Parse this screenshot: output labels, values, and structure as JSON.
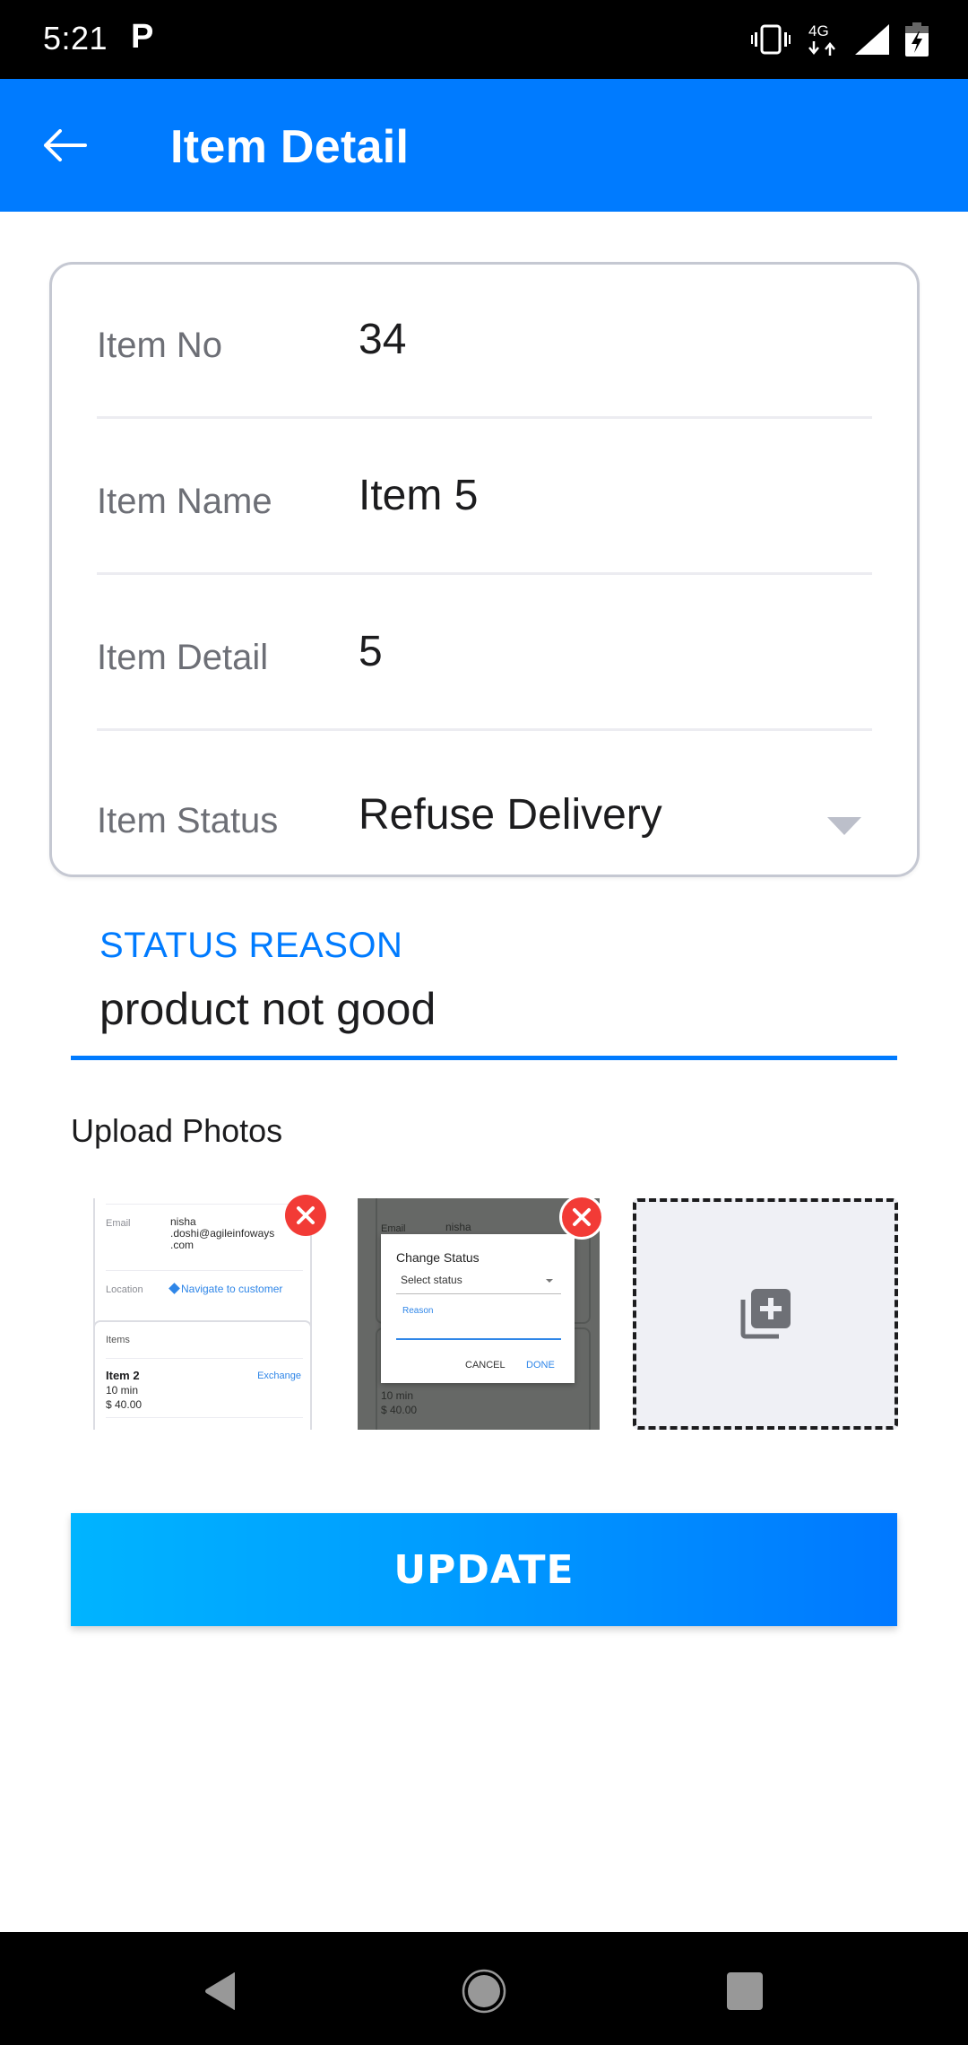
{
  "status_bar": {
    "time": "5:21",
    "notification_icon": "P",
    "network_label": "4G",
    "icons": [
      "vibrate-icon",
      "network-4g-icon",
      "signal-icon",
      "battery-charging-icon"
    ]
  },
  "app_bar": {
    "title": "Item Detail",
    "back_icon": "arrow-left-icon",
    "color": "#007bff"
  },
  "detail_card": {
    "rows": [
      {
        "label": "Item No",
        "value": "34"
      },
      {
        "label": "Item Name",
        "value": "Item 5"
      },
      {
        "label": "Item Detail",
        "value": "5"
      },
      {
        "label": "Item Status",
        "value": "Refuse Delivery"
      }
    ]
  },
  "status_reason": {
    "label": "STATUS REASON",
    "value": "product not good"
  },
  "upload": {
    "label": "Upload Photos",
    "photos": [
      {
        "email_label": "Email",
        "email_lines": [
          "nisha",
          ".doshi@agileinfoways",
          ".com"
        ],
        "location_label": "Location",
        "navigate_link": "Navigate to customer",
        "items_heading": "Items",
        "item_name": "Item 2",
        "item_action": "Exchange",
        "item_time": "10 min",
        "item_price": "$ 40.00"
      },
      {
        "email_label": "Email",
        "email_value": "nisha",
        "dialog_title": "Change Status",
        "select_placeholder": "Select status",
        "reason_label": "Reason",
        "cancel_label": "CANCEL",
        "done_label": "DONE",
        "item_time": "10 min",
        "item_price": "$ 40.00"
      }
    ],
    "add_icon": "add-photo-icon"
  },
  "update_button": {
    "label": "UPDATE"
  },
  "nav_bar": {
    "buttons": [
      "back-triangle-icon",
      "home-circle-icon",
      "recents-square-icon"
    ]
  }
}
